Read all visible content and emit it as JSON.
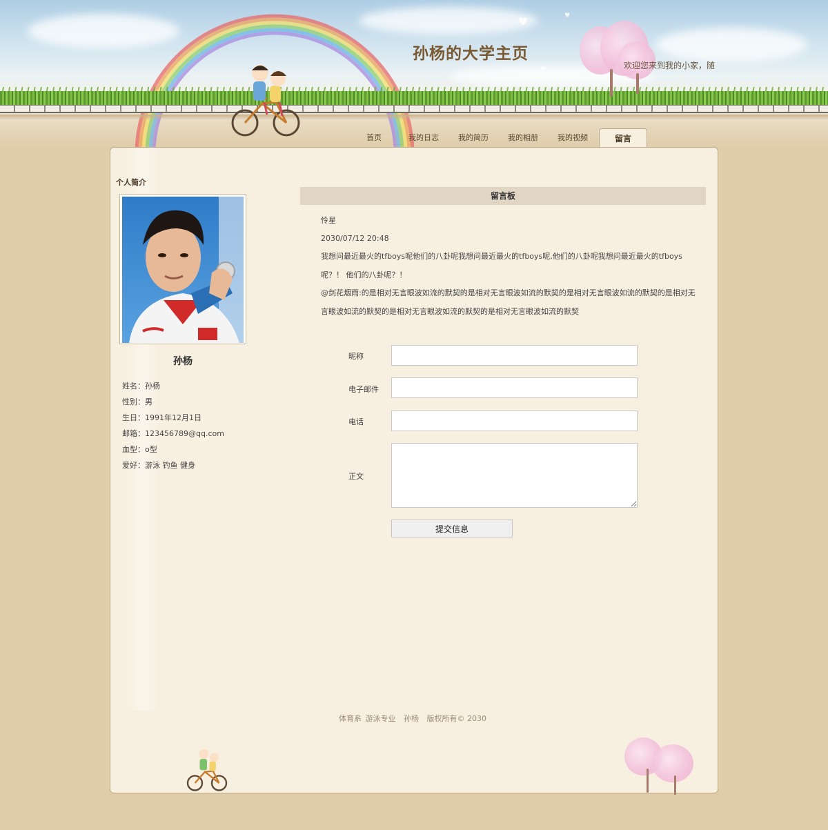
{
  "site": {
    "title": "孙杨的大学主页",
    "marquee": "欢迎您来到我的小家，随"
  },
  "nav": {
    "items": [
      {
        "label": "首页"
      },
      {
        "label": "我的日志"
      },
      {
        "label": "我的简历"
      },
      {
        "label": "我的相册"
      },
      {
        "label": "我的视频"
      },
      {
        "label": "留言"
      }
    ],
    "active": "留言"
  },
  "profile": {
    "section_title": "个人简介",
    "name": "孙杨",
    "details": [
      "姓名：孙杨",
      "性别：男",
      "生日：1991年12月1日",
      "邮箱：123456789@qq.com",
      "血型：o型",
      "爱好：游泳 钓鱼 健身"
    ]
  },
  "board": {
    "title": "留言板",
    "author": "怜星",
    "datetime": "2030/07/12 20:48",
    "message1": "我想问最近最火的tfboys呢他们的八卦呢我想问最近最火的tfboys呢,他们的八卦呢我想问最近最火的tfboys呢？！ 他们的八卦呢？！",
    "message2": "@剑花烟雨:的是相对无言眼波如流的默契的是相对无言眼波如流的默契的是相对无言眼波如流的默契的是相对无言眼波如流的默契的是相对无言眼波如流的默契的是相对无言眼波如流的默契"
  },
  "form": {
    "nickname_label": "昵称",
    "email_label": "电子邮件",
    "phone_label": "电话",
    "body_label": "正文",
    "nickname_value": "",
    "email_value": "",
    "phone_value": "",
    "body_value": "",
    "submit_label": "提交信息"
  },
  "footer": {
    "dept": "体育系",
    "major": "游泳专业",
    "name": "孙杨",
    "copyright": "版权所有© 2030"
  },
  "colors": {
    "background": "#dfcca9",
    "panel": "#f7efe0",
    "title": "#7a5a32",
    "board_header": "#e0d6c3"
  }
}
